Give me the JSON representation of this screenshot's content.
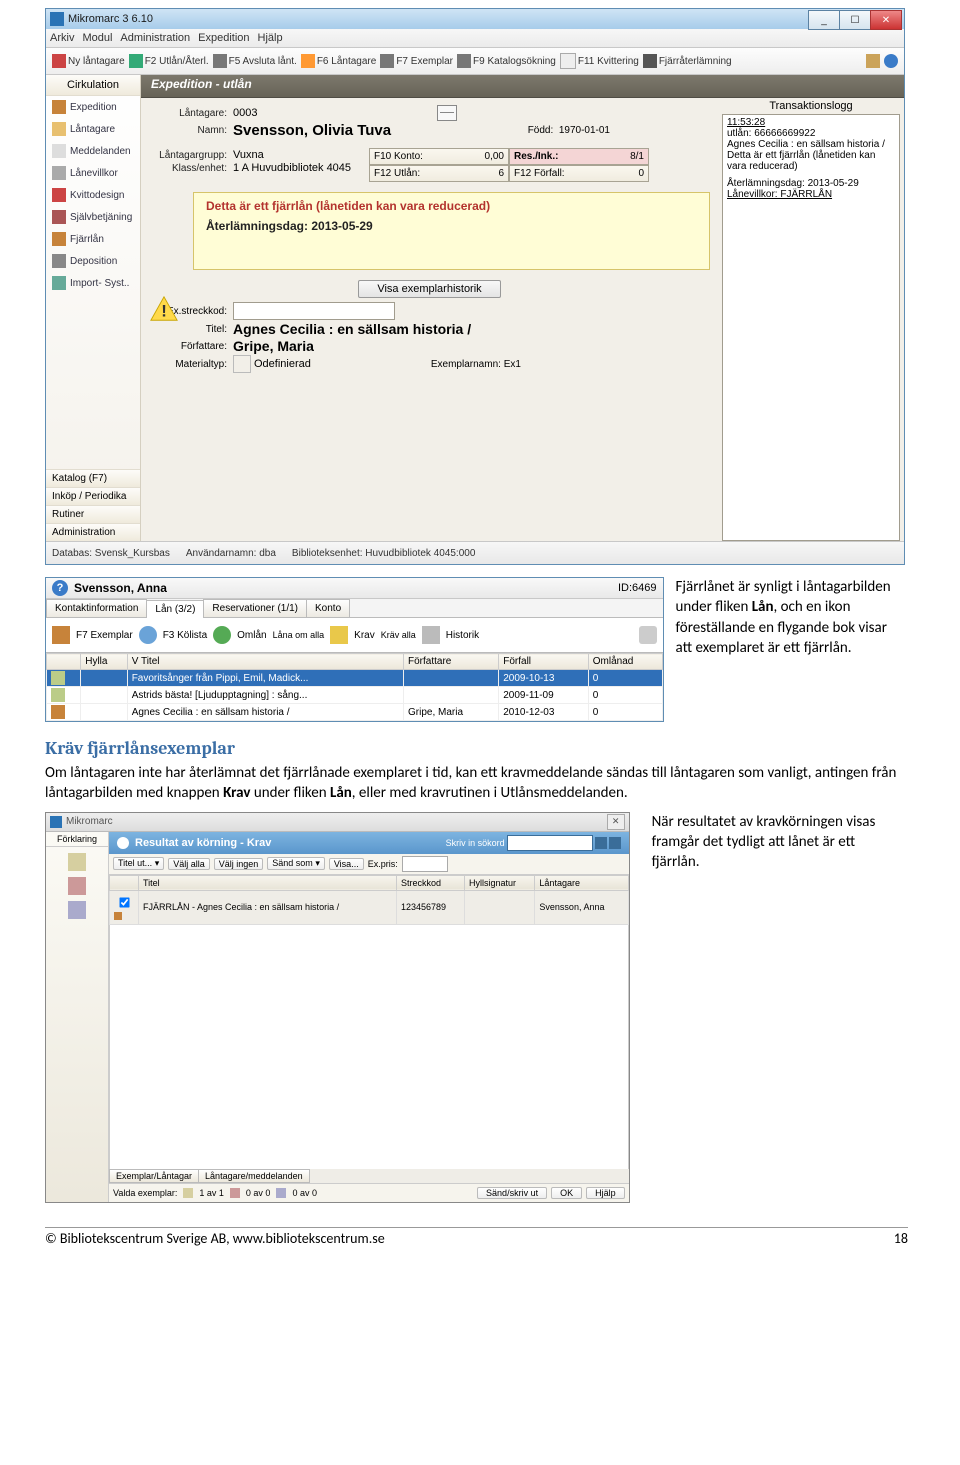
{
  "app": {
    "title": "Mikromarc 3 6.10",
    "menu": [
      "Arkiv",
      "Modul",
      "Administration",
      "Expedition",
      "Hjälp"
    ],
    "toolbar": [
      {
        "label": "Ny låntagare"
      },
      {
        "label": "F2 Utlån/Återl."
      },
      {
        "label": "F5 Avsluta lånt."
      },
      {
        "label": "F6 Låntagare"
      },
      {
        "label": "F7 Exemplar"
      },
      {
        "label": "F9 Katalogsökning"
      },
      {
        "label": "F11 Kvittering"
      },
      {
        "label": "Fjärråterlämning"
      }
    ],
    "section_title": "Expedition - utlån"
  },
  "sidebar": {
    "header": "Cirkulation",
    "items": [
      "Expedition",
      "Låntagare",
      "Meddelanden",
      "Lånevillkor",
      "Kvittodesign",
      "Självbetjäning",
      "Fjärrlån",
      "Deposition",
      "Import- Syst.."
    ],
    "bottom": [
      "Katalog (F7)",
      "Inköp / Periodika",
      "Rutiner",
      "Administration"
    ]
  },
  "borrower_card": {
    "lantagare_label": "Låntagare:",
    "lantagare": "0003",
    "namn_label": "Namn:",
    "namn": "Svensson, Olivia Tuva",
    "fodd_label": "Född:",
    "fodd": "1970-01-01",
    "grupp_label": "Låntagargrupp:",
    "grupp": "Vuxna",
    "klass_label": "Klass/enhet:",
    "klass": "1 A Huvudbibliotek 4045",
    "cells": {
      "f10": "F10 Konto:",
      "f10v": "0,00",
      "res": "Res./Ink.:",
      "resv": "8/1",
      "f12": "F12 Utlån:",
      "f12v": "6",
      "f12f": "F12 Förfall:",
      "f12fv": "0"
    },
    "alert_line1": "Detta är ett fjärrlån (lånetiden kan vara reducerad)",
    "alert_line2": "Återlämningsdag: 2013-05-29",
    "history_btn": "Visa exemplarhistorik",
    "ex_label": "Ex.streckkod:",
    "titel_label": "Titel:",
    "titel": "Agnes Cecilia : en sällsam historia /",
    "forf_label": "Författare:",
    "forf": "Gripe, Maria",
    "mat_label": "Materialtyp:",
    "mat": "Odefinierad",
    "exnamn_label": "Exemplarnamn:",
    "exnamn": "Ex1"
  },
  "log": {
    "header": "Transaktionslogg",
    "time": "11:53:28",
    "l1": "utlån: 66666669922",
    "l2": "Agnes Cecilia : en sällsam historia /",
    "l3": "Detta är ett fjärrlån (lånetiden kan vara reducerad)",
    "l4": "Återlämningsdag: 2013-05-29",
    "l5": "Lånevillkor:  FJÄRRLÅN"
  },
  "statusbar": {
    "db": "Databas: Svensk_Kursbas",
    "user": "Användarnamn: dba",
    "enhet": "Biblioteksenhet: Huvudbibliotek 4045:000"
  },
  "bor": {
    "name": "Svensson, Anna",
    "id": "ID:6469",
    "tabs": [
      "Kontaktinformation",
      "Lån (3/2)",
      "Reservationer (1/1)",
      "Konto"
    ],
    "tools": {
      "t1": "F7 Exemplar",
      "t2": "F3 Kölista",
      "t3": "Omlån",
      "t4": "Låna om alla",
      "t5": "Krav",
      "t6": "Kräv alla",
      "t7": "Historik"
    },
    "headers": [
      "",
      "Hylla",
      "V Titel",
      "Författare",
      "Förfall",
      "Omlånad"
    ],
    "rows": [
      {
        "ic": 1,
        "h": "",
        "t": "Favoritsånger från Pippi, Emil, Madick...",
        "f": "",
        "d": "2009-10-13",
        "o": "0",
        "sel": true
      },
      {
        "ic": 1,
        "h": "",
        "t": "Astrids bästa! [Ljudupptagning] : sång...",
        "f": "",
        "d": "2009-11-09",
        "o": "0"
      },
      {
        "ic": 2,
        "h": "",
        "t": "Agnes Cecilia : en sällsam historia /",
        "f": "Gripe, Maria",
        "d": "2010-12-03",
        "o": "0"
      }
    ]
  },
  "caption1": {
    "p1a": "Fjärrlånet är synligt i låntagarbilden under fliken ",
    "p1b": "Lån",
    "p1c": ", och en ikon föreställande en flygande bok visar att exemplaret är ett fjärrlån."
  },
  "sec2": {
    "h": "Kräv fjärrlånsexemplar",
    "p_a": "Om låntagaren inte har återlämnat det fjärrlånade exemplaret i tid, kan ett kravmeddelande sändas till låntagaren som vanligt, antingen från låntagarbilden med knappen ",
    "p_b": "Krav",
    "p_c": " under fliken ",
    "p_d": "Lån",
    "p_e": ", eller med kravrutinen i Utlånsmeddelanden."
  },
  "krav": {
    "wintitle": "Mikromarc",
    "side": "Förklaring",
    "bar": "Resultat av körning - Krav",
    "srch": "Skriv in sökord",
    "tool": {
      "a": "Titel ut...",
      "b": "Välj alla",
      "c": "Välj ingen",
      "d": "Sänd som",
      "e": "Visa...",
      "f": "Ex.pris:"
    },
    "headers": [
      "",
      "Titel",
      "Streckkod",
      "Hyllsignatur",
      "Låntagare"
    ],
    "row": {
      "t": "FJÄRRLÅN - Agnes Cecilia : en sällsam historia /",
      "s": "123456789",
      "h": "",
      "l": "Svensson, Anna"
    },
    "tabs": [
      "Exemplar/Låntagar",
      "Låntagare/meddelanden"
    ],
    "foot": {
      "v": "Valda exemplar:",
      "a": "1 av 1",
      "b": "0 av 0",
      "c": "0 av 0",
      "btns": [
        "Sänd/skriv ut",
        "OK",
        "Hjälp"
      ]
    }
  },
  "caption2": "När resultatet av kravkörningen visas framgår det tydligt att lånet är ett fjärrlån.",
  "footer": {
    "l": "© Bibliotekscentrum Sverige AB, www.bibliotekscentrum.se",
    "r": "18"
  }
}
